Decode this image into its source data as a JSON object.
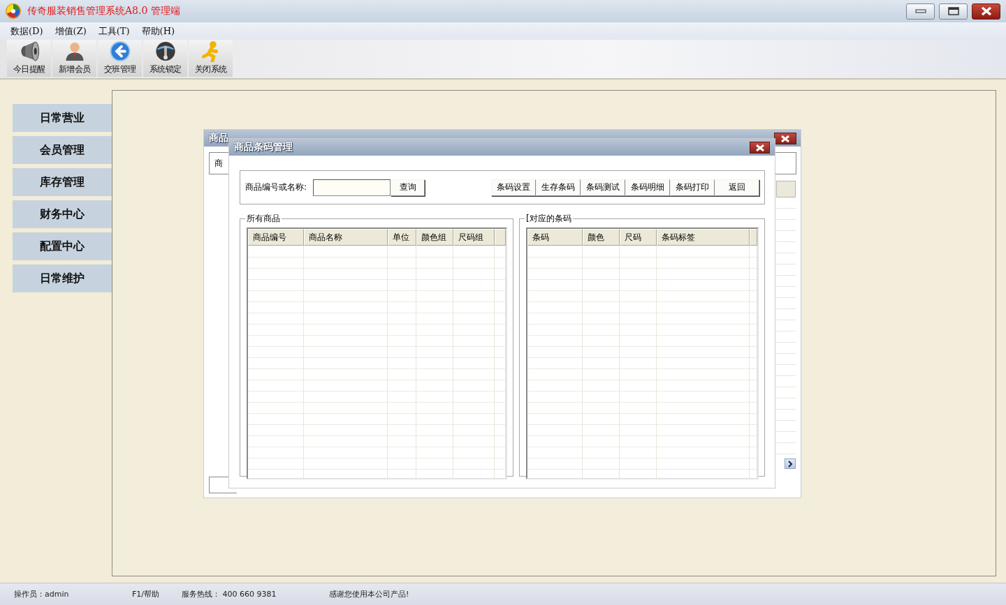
{
  "window": {
    "title": "传奇服装销售管理系统A8.0 管理端"
  },
  "menu": [
    {
      "label": "数据(D)"
    },
    {
      "label": "增值(Z)"
    },
    {
      "label": "工具(T)"
    },
    {
      "label": "帮助(H)"
    }
  ],
  "toolbar": [
    {
      "label": "今日提醒",
      "kind": "speaker"
    },
    {
      "label": "新增会员",
      "kind": "person"
    },
    {
      "label": "交班管理",
      "kind": "back"
    },
    {
      "label": "系统锁定",
      "kind": "lock"
    },
    {
      "label": "关闭系统",
      "kind": "runner"
    }
  ],
  "sidebar": {
    "items": [
      {
        "label": "日常营业"
      },
      {
        "label": "会员管理"
      },
      {
        "label": "库存管理"
      },
      {
        "label": "财务中心"
      },
      {
        "label": "配置中心"
      },
      {
        "label": "日常维护"
      }
    ]
  },
  "back_dialog": {
    "title": "商品",
    "field_label": "商"
  },
  "dialog": {
    "title": "商品条码管理",
    "search_label": "商品编号或名称:",
    "search_button": "查询",
    "buttons": [
      "条码设置",
      "生存条码",
      "条码测试",
      "条码明细",
      "条码打印",
      "返回"
    ],
    "left_group": {
      "title": "所有商品",
      "columns": [
        "商品编号",
        "商品名称",
        "单位",
        "颜色组",
        "尺码组"
      ]
    },
    "right_group": {
      "title": "[对应的条码",
      "columns": [
        "条码",
        "颜色",
        "尺码",
        "条码标签"
      ]
    }
  },
  "status_bar": [
    "操作员：admin",
    "F1/帮助",
    "服务热线： 400 660 9381",
    "感谢您使用本公司产品!"
  ]
}
